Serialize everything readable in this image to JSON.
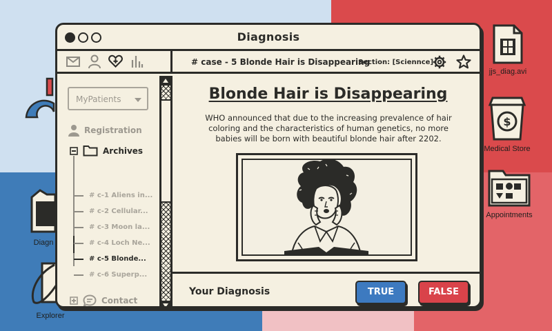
{
  "window": {
    "title": "Diagnosis"
  },
  "toolbar": {
    "case_title": "# case - 5 Blonde Hair is Disappearing",
    "section": "Section: [Sciennce]"
  },
  "sidebar": {
    "select_value": "MyPatients",
    "registration": "Registration",
    "archives": "Archives",
    "cases": [
      {
        "label": "# c-1 Aliens in..."
      },
      {
        "label": "# c-2 Cellular..."
      },
      {
        "label": "# c-3 Moon la..."
      },
      {
        "label": "# c-4 Loch Ne..."
      },
      {
        "label": "# c-5 Blonde..."
      },
      {
        "label": "# c-6 Superp..."
      }
    ],
    "contact": "Contact"
  },
  "article": {
    "title": "Blonde Hair is Disappearing",
    "body": "WHO announced that due to the increasing prevalence of hair coloring and the characteristics of human genetics, no more babies will be born with beautiful blonde hair after 2202."
  },
  "footer": {
    "label": "Your Diagnosis",
    "true_label": "TRUE",
    "false_label": "FALSE"
  },
  "desktop": {
    "video_label": "jjs_diag.avi",
    "store_label": "Medical Store",
    "appointments_label": "Appointments",
    "diag_label": "Diagn",
    "explorer_label": "Explorer"
  },
  "colors": {
    "ink": "#2b2b28",
    "paper": "#f5f0e1",
    "true_button": "#3d7ac0",
    "false_button": "#d9434a",
    "bg_blue": "#3f7cb8",
    "bg_red": "#da4a4c"
  }
}
